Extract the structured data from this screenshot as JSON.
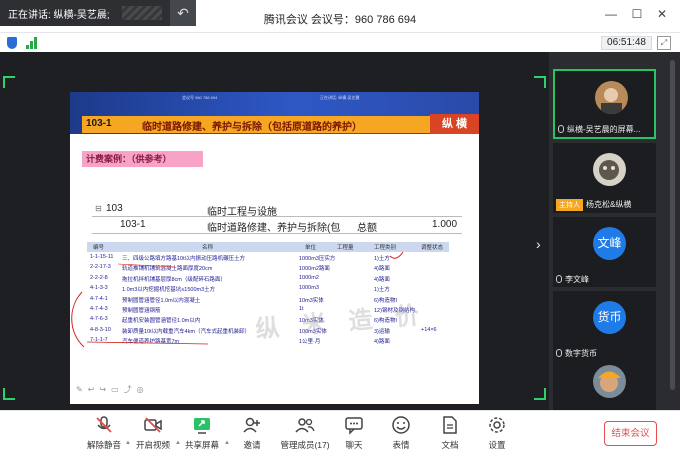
{
  "window": {
    "speaking_label": "正在讲话: 纵横-吴艺晨;",
    "meeting_title": "腾讯会议  会议号：960 786 694",
    "timer": "06:51:48"
  },
  "slide": {
    "header_mini_left": "会议号 960 786 694",
    "header_mini_right": "正在讲话: 纵横-吴艺晨",
    "section_number": "103-1",
    "section_title": "临时道路修建、养护与拆除（包括原道路的养护）",
    "brand": "纵 横",
    "case_label": "计费案例：（供参考）",
    "fee_rows": [
      {
        "code": "103",
        "name": "临时工程与设施",
        "col": "",
        "amount": ""
      },
      {
        "code": "103-1",
        "name": "临时道路修建、养护与拆除(包",
        "col": "总额",
        "amount": "1.000"
      }
    ],
    "table_headers": [
      "编号",
      "名称",
      "单位",
      "工程量",
      "工程类别",
      "调整状态"
    ],
    "table_rows": [
      {
        "code": "1-1-15-11",
        "name": "三、四级公路填方路基10t以内振动压路机碾压土方",
        "unit": "1000m3压实方",
        "qty": "",
        "cat": "1)土方",
        "adj": ""
      },
      {
        "code": "2-2-17-3",
        "name": "轨道推铺机铺筑混凝土路面厚度20cm",
        "unit": "1000m2路面",
        "qty": "",
        "cat": "4)路面",
        "adj": ""
      },
      {
        "code": "2-2-2-8",
        "name": "拖拉机拌机铺基层厚8cm（级配碎石路面）",
        "unit": "1000m2",
        "qty": "",
        "cat": "4)路面",
        "adj": ""
      },
      {
        "code": "4-1-3-3",
        "name": "1.0m3以内挖掘机挖基坑≤1500m3土方",
        "unit": "1000m3",
        "qty": "",
        "cat": "1)土方",
        "adj": ""
      },
      {
        "code": "4-7-4-1",
        "name": "预制圆管涵管径1.0m以内混凝土",
        "unit": "10m3实体",
        "qty": "",
        "cat": "6)构造物Ⅰ",
        "adj": ""
      },
      {
        "code": "4-7-4-3",
        "name": "预制圆管涵钢筋",
        "unit": "1t",
        "qty": "",
        "cat": "12)钢材及钢结构",
        "adj": ""
      },
      {
        "code": "4-7-6-3",
        "name": "起重机安装圆管涵管径1.0m以内",
        "unit": "10m3实体",
        "qty": "",
        "cat": "6)构造物Ⅰ",
        "adj": ""
      },
      {
        "code": "4-8-3-10",
        "name": "装卸质量10t以内载重汽车4km（汽车式起重机装卸）",
        "unit": "100m3实体",
        "qty": "",
        "cat": "3)运输",
        "adj": "+14×6"
      },
      {
        "code": "7-1-1-7",
        "name": "汽车便道养护路基宽7m",
        "unit": "1公里·月",
        "qty": "",
        "cat": "4)路面",
        "adj": ""
      }
    ],
    "watermark": "纵 米 造 价"
  },
  "participants": [
    {
      "name": "纵横-吴艺晨的屏幕...",
      "avatar": "photo",
      "active": true
    },
    {
      "name": "杨克松&纵横",
      "avatar": "photo-cat",
      "host": true,
      "host_label": "主持人"
    },
    {
      "name": "李文峰",
      "avatar": "文峰"
    },
    {
      "name": "数字货币",
      "avatar": "货币"
    },
    {
      "name": "",
      "avatar": "photo-helmet"
    }
  ],
  "toolbar": {
    "unmute": "解除静音",
    "video": "开启视频",
    "share": "共享屏幕",
    "invite": "邀请",
    "members": "管理成员(17)",
    "chat": "聊天",
    "reactions": "表情",
    "docs": "文档",
    "settings": "设置",
    "end": "结束会议"
  },
  "colors": {
    "accent_green": "#29c267",
    "end_red": "#e34d4d",
    "slide_orange": "#f5a623",
    "slide_pink": "#f7a2c7"
  }
}
